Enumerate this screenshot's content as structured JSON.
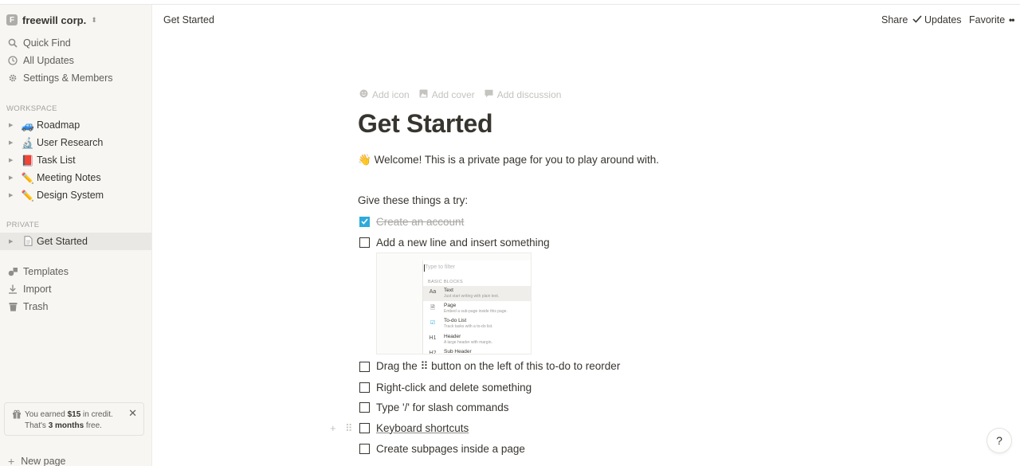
{
  "workspace": {
    "initial": "F",
    "name": "freewill corp."
  },
  "nav": [
    {
      "label": "Quick Find",
      "icon": "search-icon"
    },
    {
      "label": "All Updates",
      "icon": "clock-icon"
    },
    {
      "label": "Settings & Members",
      "icon": "gear-icon"
    }
  ],
  "sections": {
    "workspace": "WORKSPACE",
    "private": "PRIVATE"
  },
  "workspace_pages": [
    {
      "emoji": "🚙",
      "label": "Roadmap"
    },
    {
      "emoji": "🔬",
      "label": "User Research"
    },
    {
      "emoji": "📕",
      "label": "Task List"
    },
    {
      "emoji": "✏️",
      "label": "Meeting Notes"
    },
    {
      "emoji": "✏️",
      "label": "Design System"
    }
  ],
  "private_pages": [
    {
      "label": "Get Started",
      "icon": "page-icon"
    }
  ],
  "tools": [
    {
      "label": "Templates",
      "icon": "shapes-icon"
    },
    {
      "label": "Import",
      "icon": "download-icon"
    },
    {
      "label": "Trash",
      "icon": "trash-icon"
    }
  ],
  "credit": {
    "prefix": "You earned ",
    "amount": "$15",
    "suffix": " in credit.",
    "line2_prefix": "That's ",
    "months": "3 months",
    "line2_suffix": " free."
  },
  "new_page": "New page",
  "topbar": {
    "breadcrumb": "Get Started",
    "share": "Share",
    "updates": "Updates",
    "favorite": "Favorite",
    "more": "••"
  },
  "page": {
    "actions": {
      "add_icon": "Add icon",
      "add_cover": "Add cover",
      "add_discussion": "Add discussion"
    },
    "title": "Get Started",
    "welcome_emoji": "👋",
    "welcome": "Welcome! This is a private page for you to play around with.",
    "try_heading": "Give these things a try:",
    "todos": [
      {
        "text": "Create an account",
        "checked": true
      },
      {
        "text": "Add a new line and insert something",
        "checked": false
      },
      {
        "text": "Drag the ⠿ button on the left of this to-do to reorder",
        "checked": false
      },
      {
        "text": "Right-click and delete something",
        "checked": false
      },
      {
        "text": "Type '/' for slash commands",
        "checked": false
      },
      {
        "text": "Keyboard shortcuts",
        "checked": false
      },
      {
        "text": "Create subpages inside a page",
        "checked": false
      }
    ]
  },
  "embed": {
    "filter_placeholder": "Type to filter",
    "section": "BASIC BLOCKS",
    "items": [
      {
        "icon": "Aa",
        "title": "Text",
        "desc": "Just start writing with plain text."
      },
      {
        "icon": "🗎",
        "title": "Page",
        "desc": "Embed a sub-page inside this page."
      },
      {
        "icon": "☑",
        "title": "To-do List",
        "desc": "Track tasks with a to-do list."
      },
      {
        "icon": "H1",
        "title": "Header",
        "desc": "A large header with margin."
      },
      {
        "icon": "H2",
        "title": "Sub Header",
        "desc": ""
      }
    ]
  },
  "help": "?"
}
